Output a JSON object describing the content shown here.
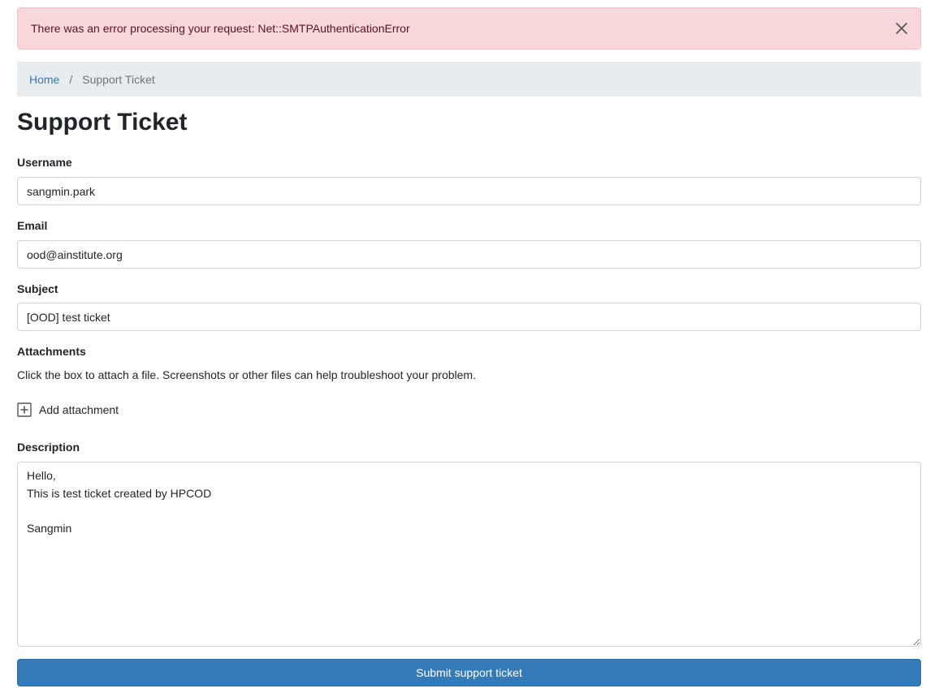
{
  "alert": {
    "message": "There was an error processing your request: Net::SMTPAuthenticationError",
    "close_icon": "close-icon",
    "background_color": "#f8d7da"
  },
  "breadcrumb": {
    "home": "Home",
    "separator": "/",
    "current": "Support Ticket"
  },
  "page": {
    "title": "Support Ticket"
  },
  "form": {
    "username": {
      "label": "Username",
      "value": "sangmin.park"
    },
    "email": {
      "label": "Email",
      "value": "ood@ainstitute.org"
    },
    "subject": {
      "label": "Subject",
      "value": "[OOD] test ticket"
    },
    "attachments": {
      "label": "Attachments",
      "help": "Click the box to attach a file. Screenshots or other files can help troubleshoot your problem.",
      "add_label": "Add attachment",
      "add_icon": "plus-square-icon"
    },
    "description": {
      "label": "Description",
      "value": "Hello,\nThis is test ticket created by HPCOD\n\nSangmin"
    },
    "submit_label": "Submit support ticket",
    "accent_color": "#337ab7"
  }
}
